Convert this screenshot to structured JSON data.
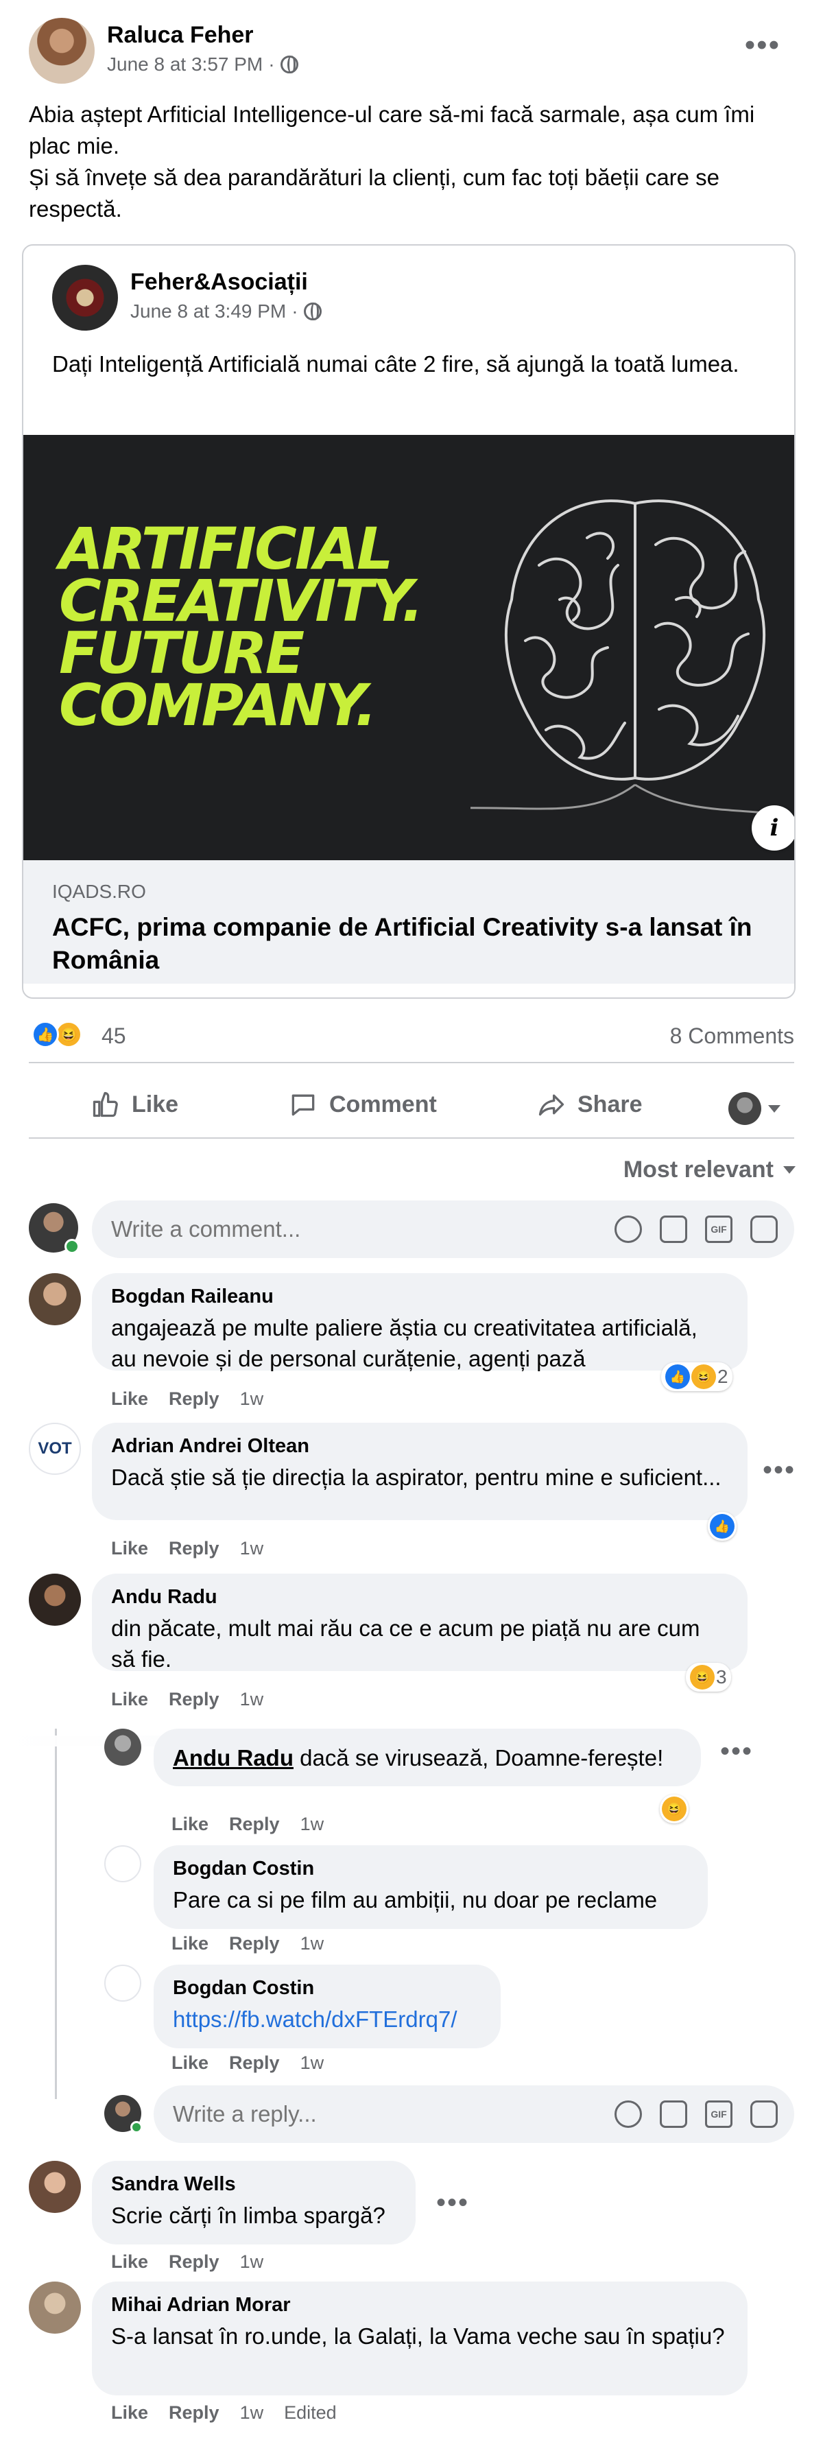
{
  "post": {
    "author": "Raluca Feher",
    "timestamp": "June 8 at 3:57 PM",
    "separator": "·",
    "audience_icon": "globe-icon",
    "more_icon": "more-dots-icon",
    "text_line1": "Abia aștept Arfiticial Intelligence-ul care să-mi facă sarmale, așa cum îmi plac mie.",
    "text_line2": "Și să învețe să dea parandărături la clienți, cum fac toți băeții care se respectă."
  },
  "shared": {
    "author": "Feher&Asociații",
    "timestamp": "June 8 at 3:49 PM",
    "separator": "·",
    "text": "Dați Inteligență Artificială numai câte 2 fire, să ajungă la toată lumea.",
    "image_headline": [
      "ARTIFICIAL",
      "CREATIVITY.",
      "FUTURE",
      "COMPANY."
    ],
    "info_icon": "i",
    "link_domain": "IQADS.RO",
    "link_title": "ACFC, prima companie de Artificial Creativity s-a lansat în România"
  },
  "stats": {
    "reaction_count": "45",
    "comments": "8 Comments"
  },
  "actions": {
    "like": "Like",
    "comment": "Comment",
    "share": "Share"
  },
  "sort": {
    "label": "Most relevant"
  },
  "composer": {
    "placeholder": "Write a comment...",
    "reply_placeholder": "Write a reply...",
    "gif": "GIF"
  },
  "comments": [
    {
      "name": "Bogdan Raileanu",
      "text": "angajează pe multe paliere ăștia cu creativitatea artificială, au nevoie și de personal curățenie, agenți pază",
      "like": "Like",
      "reply": "Reply",
      "time": "1w",
      "reaction_count": "2"
    },
    {
      "name": "Adrian Andrei Oltean",
      "avatar_text": "VOT",
      "text": "Dacă știe să ție direcția la aspirator, pentru mine e suficient...",
      "like": "Like",
      "reply": "Reply",
      "time": "1w"
    },
    {
      "name": "Andu Radu",
      "text": "din păcate, mult mai rău ca ce e acum pe piață nu are cum să fie.",
      "like": "Like",
      "reply": "Reply",
      "time": "1w",
      "reaction_count": "3"
    },
    {
      "mention": "Andu Radu",
      "text": "dacă se virusează, Doamne-ferește!",
      "like": "Like",
      "reply": "Reply",
      "time": "1w"
    },
    {
      "name": "Bogdan Costin",
      "text": "Pare ca si pe film au ambiții, nu doar pe reclame",
      "like": "Like",
      "reply": "Reply",
      "time": "1w"
    },
    {
      "name": "Bogdan Costin",
      "text": "https://fb.watch/dxFTErdrq7/",
      "like": "Like",
      "reply": "Reply",
      "time": "1w"
    },
    {
      "name": "Sandra Wells",
      "text": "Scrie cărți în limba spargă?",
      "like": "Like",
      "reply": "Reply",
      "time": "1w"
    },
    {
      "name": "Mihai Adrian Morar",
      "text": "S-a lansat în ro.unde, la Galați, la Vama veche sau în spațiu?",
      "like": "Like",
      "reply": "Reply",
      "time": "1w",
      "edited": "Edited"
    }
  ]
}
